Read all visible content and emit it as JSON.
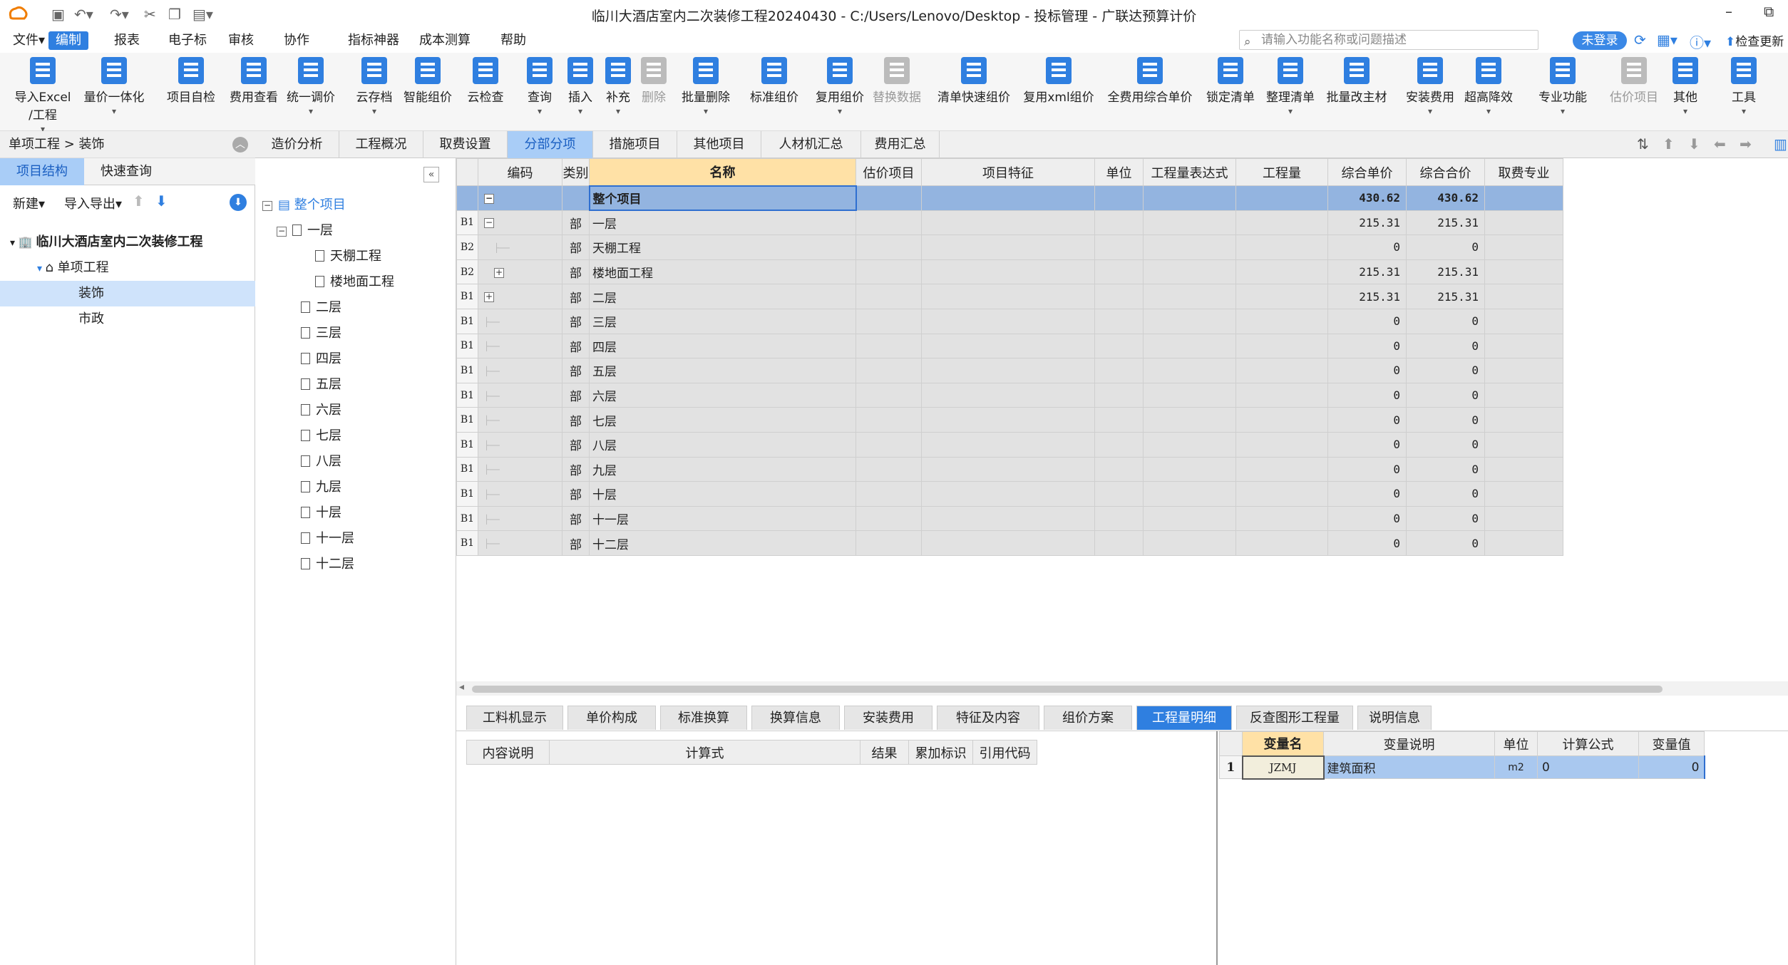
{
  "window": {
    "title": "临川大酒店室内二次装修工程20240430 - C:/Users/Lenovo/Desktop - 投标管理 - 广联达预算计价"
  },
  "menu": [
    "文件▾",
    "编制",
    "报表",
    "电子标",
    "审核",
    "协作",
    "指标神器",
    "成本测算",
    "帮助"
  ],
  "search": {
    "placeholder": "请输入功能名称或问题描述"
  },
  "login": "未登录",
  "check_update": "检查更新",
  "ribbon": [
    {
      "label": "导入Excel",
      "label2": "/工程",
      "color": "#2f7fe0",
      "arrow": true
    },
    {
      "label": "量价一体化",
      "color": "#2f7fe0",
      "arrow": true
    },
    {
      "label": "项目自检",
      "color": "#2f7fe0",
      "arrow": false
    },
    {
      "label": "费用查看",
      "color": "#2f7fe0",
      "arrow": false
    },
    {
      "label": "统一调价",
      "color": "#2f7fe0",
      "arrow": true
    },
    {
      "label": "云存档",
      "color": "#2f7fe0",
      "arrow": true
    },
    {
      "label": "智能组价",
      "color": "#2f7fe0",
      "arrow": false
    },
    {
      "label": "云检查",
      "color": "#2f7fe0",
      "arrow": false
    },
    {
      "label": "查询",
      "color": "#2f7fe0",
      "arrow": true
    },
    {
      "label": "插入",
      "color": "#2f7fe0",
      "arrow": true
    },
    {
      "label": "补充",
      "color": "#2f7fe0",
      "arrow": true
    },
    {
      "label": "删除",
      "color": "#bbbbbb",
      "arrow": false,
      "disabled": true
    },
    {
      "label": "批量删除",
      "color": "#2f7fe0",
      "arrow": true
    },
    {
      "label": "标准组价",
      "color": "#2f7fe0",
      "arrow": false
    },
    {
      "label": "复用组价",
      "color": "#2f7fe0",
      "arrow": true
    },
    {
      "label": "替换数据",
      "color": "#bbbbbb",
      "arrow": false,
      "disabled": true
    },
    {
      "label": "清单快速组价",
      "color": "#2f7fe0",
      "arrow": false
    },
    {
      "label": "复用xml组价",
      "color": "#2f7fe0",
      "arrow": false
    },
    {
      "label": "全费用综合单价",
      "color": "#2f7fe0",
      "arrow": false
    },
    {
      "label": "锁定清单",
      "color": "#2f7fe0",
      "arrow": false
    },
    {
      "label": "整理清单",
      "color": "#2f7fe0",
      "arrow": true
    },
    {
      "label": "批量改主材",
      "color": "#2f7fe0",
      "arrow": false
    },
    {
      "label": "安装费用",
      "color": "#2f7fe0",
      "arrow": true
    },
    {
      "label": "超高降效",
      "color": "#2f7fe0",
      "arrow": true
    },
    {
      "label": "专业功能",
      "color": "#2f7fe0",
      "arrow": true
    },
    {
      "label": "估价项目",
      "color": "#bbbbbb",
      "arrow": false,
      "disabled": true
    },
    {
      "label": "其他",
      "color": "#2f7fe0",
      "arrow": true
    },
    {
      "label": "工具",
      "color": "#2f7fe0",
      "arrow": true
    }
  ],
  "breadcrumb": "单项工程 > 装饰",
  "main_tabs": [
    "造价分析",
    "工程概况",
    "取费设置",
    "分部分项",
    "措施项目",
    "其他项目",
    "人材机汇总",
    "费用汇总"
  ],
  "left": {
    "tabs": [
      "项目结构",
      "快速查询"
    ],
    "new_label": "新建▾",
    "import_label": "导入导出▾",
    "tree": [
      {
        "label": "临川大酒店室内二次装修工程",
        "level": 0,
        "bold": true
      },
      {
        "label": "单项工程",
        "level": 1
      },
      {
        "label": "装饰",
        "level": 2,
        "selected": true
      },
      {
        "label": "市政",
        "level": 2
      }
    ]
  },
  "mid_tree": [
    {
      "label": "整个项目",
      "level": 0,
      "root": true
    },
    {
      "label": "一层",
      "level": 1,
      "exp": "−"
    },
    {
      "label": "天棚工程",
      "level": 2
    },
    {
      "label": "楼地面工程",
      "level": 2
    },
    {
      "label": "二层",
      "level": 1
    },
    {
      "label": "三层",
      "level": 1
    },
    {
      "label": "四层",
      "level": 1
    },
    {
      "label": "五层",
      "level": 1
    },
    {
      "label": "六层",
      "level": 1
    },
    {
      "label": "七层",
      "level": 1
    },
    {
      "label": "八层",
      "level": 1
    },
    {
      "label": "九层",
      "level": 1
    },
    {
      "label": "十层",
      "level": 1
    },
    {
      "label": "十一层",
      "level": 1
    },
    {
      "label": "十二层",
      "level": 1
    }
  ],
  "grid": {
    "headers": [
      "编码",
      "类别",
      "名称",
      "估价项目",
      "项目特征",
      "单位",
      "工程量表达式",
      "工程量",
      "综合单价",
      "综合合价",
      "取费专业"
    ],
    "rows": [
      {
        "rn": "",
        "code_exp": "−",
        "type": "",
        "name": "整个项目",
        "price": "430.62",
        "total": "430.62",
        "sel": true
      },
      {
        "rn": "B1",
        "code_exp": "−",
        "type": "部",
        "name": "一层",
        "price": "215.31",
        "total": "215.31"
      },
      {
        "rn": "B2",
        "code_exp": "",
        "type": "部",
        "name": "天棚工程",
        "price": "0",
        "total": "0",
        "indent": 2
      },
      {
        "rn": "B2",
        "code_exp": "+",
        "type": "部",
        "name": "楼地面工程",
        "price": "215.31",
        "total": "215.31",
        "indent": 2
      },
      {
        "rn": "B1",
        "code_exp": "+",
        "type": "部",
        "name": "二层",
        "price": "215.31",
        "total": "215.31"
      },
      {
        "rn": "B1",
        "code_exp": "",
        "type": "部",
        "name": "三层",
        "price": "0",
        "total": "0"
      },
      {
        "rn": "B1",
        "code_exp": "",
        "type": "部",
        "name": "四层",
        "price": "0",
        "total": "0"
      },
      {
        "rn": "B1",
        "code_exp": "",
        "type": "部",
        "name": "五层",
        "price": "0",
        "total": "0"
      },
      {
        "rn": "B1",
        "code_exp": "",
        "type": "部",
        "name": "六层",
        "price": "0",
        "total": "0"
      },
      {
        "rn": "B1",
        "code_exp": "",
        "type": "部",
        "name": "七层",
        "price": "0",
        "total": "0"
      },
      {
        "rn": "B1",
        "code_exp": "",
        "type": "部",
        "name": "八层",
        "price": "0",
        "total": "0"
      },
      {
        "rn": "B1",
        "code_exp": "",
        "type": "部",
        "name": "九层",
        "price": "0",
        "total": "0"
      },
      {
        "rn": "B1",
        "code_exp": "",
        "type": "部",
        "name": "十层",
        "price": "0",
        "total": "0"
      },
      {
        "rn": "B1",
        "code_exp": "",
        "type": "部",
        "name": "十一层",
        "price": "0",
        "total": "0"
      },
      {
        "rn": "B1",
        "code_exp": "",
        "type": "部",
        "name": "十二层",
        "price": "0",
        "total": "0"
      }
    ]
  },
  "bottom_tabs": [
    "工料机显示",
    "单价构成",
    "标准换算",
    "换算信息",
    "安装费用",
    "特征及内容",
    "组价方案",
    "工程量明细",
    "反查图形工程量",
    "说明信息"
  ],
  "bottom_left_headers": [
    "内容说明",
    "计算式",
    "结果",
    "累加标识",
    "引用代码"
  ],
  "vars": {
    "headers": [
      "变量名",
      "变量说明",
      "单位",
      "计算公式",
      "变量值"
    ],
    "rows": [
      {
        "no": "1",
        "name": "JZMJ",
        "desc": "建筑面积",
        "unit": "m2",
        "formula": "0",
        "value": "0"
      }
    ]
  },
  "colors": {
    "accent": "#2f7fe0",
    "selected_row": "#93b4e0",
    "header_highlight": "#ffe1a6"
  }
}
